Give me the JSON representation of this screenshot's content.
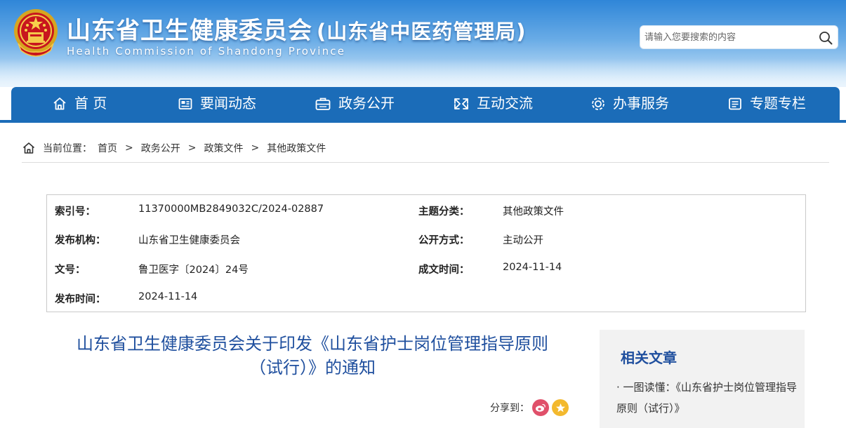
{
  "header": {
    "title": "山东省卫生健康委员会",
    "title_sub": "(山东省中医药管理局)",
    "title_en": "Health Commission  of  Shandong  Province",
    "emblem_icon": "national-emblem-icon",
    "search_placeholder": "请输入您要搜索的内容"
  },
  "nav": {
    "items": [
      {
        "label": "首 页",
        "icon": "home-icon"
      },
      {
        "label": "要闻动态",
        "icon": "news-icon"
      },
      {
        "label": "政务公开",
        "icon": "briefcase-icon"
      },
      {
        "label": "互动交流",
        "icon": "exchange-icon"
      },
      {
        "label": "办事服务",
        "icon": "service-icon"
      },
      {
        "label": "专题专栏",
        "icon": "topic-icon"
      }
    ]
  },
  "breadcrumb": {
    "label": "当前位置：",
    "items": [
      "首页",
      "政务公开",
      "政策文件",
      "其他政策文件"
    ],
    "separator": ">"
  },
  "meta": {
    "index_label": "索引号：",
    "index_value": "11370000MB2849032C/2024-02887",
    "category_label": "主题分类：",
    "category_value": "其他政策文件",
    "publisher_label": "发布机构：",
    "publisher_value": "山东省卫生健康委员会",
    "disclosure_label": "公开方式：",
    "disclosure_value": "主动公开",
    "docno_label": "文号：",
    "docno_value": "鲁卫医字〔2024〕24号",
    "created_label": "成文时间：",
    "created_value": "2024-11-14",
    "published_label": "发布时间：",
    "published_value": "2024-11-14"
  },
  "article": {
    "title_line1": "山东省卫生健康委员会关于印发《山东省护士岗位管理指导原则",
    "title_line2": "（试行）》的通知",
    "share_label": "分享到："
  },
  "related": {
    "title": "相关文章",
    "items": [
      "· 一图读懂：《山东省护士岗位管理指导原则（试行）》"
    ]
  },
  "colors": {
    "nav_blue": "#1b6cb8",
    "title_blue": "#1f4f9e",
    "weibo_red": "#e0506a",
    "favorite_gold": "#f3b92e"
  }
}
